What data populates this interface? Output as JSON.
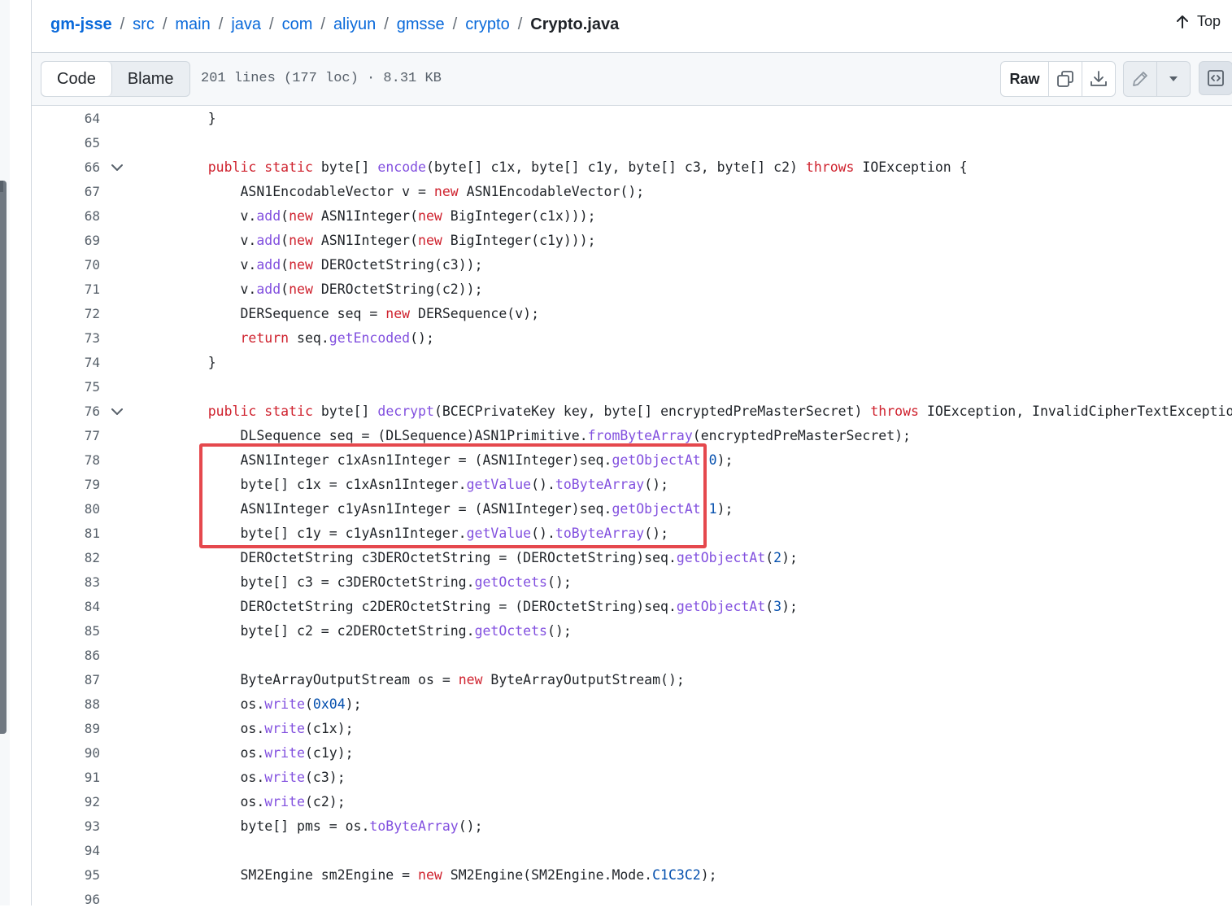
{
  "breadcrumb": {
    "repo": "gm-jsse",
    "segments": [
      "src",
      "main",
      "java",
      "com",
      "aliyun",
      "gmsse",
      "crypto"
    ],
    "separator": "/",
    "current_file": "Crypto.java"
  },
  "top_link": {
    "label": "Top",
    "icon": "arrow-up-icon"
  },
  "file_header": {
    "tabs": [
      "Code",
      "Blame"
    ],
    "active_tab": "Code",
    "meta": "201 lines (177 loc) · 8.31 KB",
    "raw_label": "Raw",
    "icons": [
      "copy-icon",
      "download-icon",
      "pencil-icon",
      "triangle-down-icon",
      "code-symbols-icon"
    ]
  },
  "highlight": {
    "color": "#e5484d",
    "lines": [
      78,
      81
    ]
  },
  "code_lines": [
    {
      "n": "64",
      "t": "    }"
    },
    {
      "n": "65",
      "t": ""
    },
    {
      "n": "66",
      "t": "    public static byte[] encode(byte[] c1x, byte[] c1y, byte[] c3, byte[] c2) throws IOException {",
      "fold": true
    },
    {
      "n": "67",
      "t": "        ASN1EncodableVector v = new ASN1EncodableVector();"
    },
    {
      "n": "68",
      "t": "        v.add(new ASN1Integer(new BigInteger(c1x)));"
    },
    {
      "n": "69",
      "t": "        v.add(new ASN1Integer(new BigInteger(c1y)));"
    },
    {
      "n": "70",
      "t": "        v.add(new DEROctetString(c3));"
    },
    {
      "n": "71",
      "t": "        v.add(new DEROctetString(c2));"
    },
    {
      "n": "72",
      "t": "        DERSequence seq = new DERSequence(v);"
    },
    {
      "n": "73",
      "t": "        return seq.getEncoded();"
    },
    {
      "n": "74",
      "t": "    }"
    },
    {
      "n": "75",
      "t": ""
    },
    {
      "n": "76",
      "t": "    public static byte[] decrypt(BCECPrivateKey key, byte[] encryptedPreMasterSecret) throws IOException, InvalidCipherTextException {",
      "fold": true
    },
    {
      "n": "77",
      "t": "        DLSequence seq = (DLSequence)ASN1Primitive.fromByteArray(encryptedPreMasterSecret);"
    },
    {
      "n": "78",
      "t": "        ASN1Integer c1xAsn1Integer = (ASN1Integer)seq.getObjectAt(0);"
    },
    {
      "n": "79",
      "t": "        byte[] c1x = c1xAsn1Integer.getValue().toByteArray();"
    },
    {
      "n": "80",
      "t": "        ASN1Integer c1yAsn1Integer = (ASN1Integer)seq.getObjectAt(1);"
    },
    {
      "n": "81",
      "t": "        byte[] c1y = c1yAsn1Integer.getValue().toByteArray();"
    },
    {
      "n": "82",
      "t": "        DEROctetString c3DEROctetString = (DEROctetString)seq.getObjectAt(2);"
    },
    {
      "n": "83",
      "t": "        byte[] c3 = c3DEROctetString.getOctets();"
    },
    {
      "n": "84",
      "t": "        DEROctetString c2DEROctetString = (DEROctetString)seq.getObjectAt(3);"
    },
    {
      "n": "85",
      "t": "        byte[] c2 = c2DEROctetString.getOctets();"
    },
    {
      "n": "86",
      "t": ""
    },
    {
      "n": "87",
      "t": "        ByteArrayOutputStream os = new ByteArrayOutputStream();"
    },
    {
      "n": "88",
      "t": "        os.write(0x04);"
    },
    {
      "n": "89",
      "t": "        os.write(c1x);"
    },
    {
      "n": "90",
      "t": "        os.write(c1y);"
    },
    {
      "n": "91",
      "t": "        os.write(c3);"
    },
    {
      "n": "92",
      "t": "        os.write(c2);"
    },
    {
      "n": "93",
      "t": "        byte[] pms = os.toByteArray();"
    },
    {
      "n": "94",
      "t": ""
    },
    {
      "n": "95",
      "t": "        SM2Engine sm2Engine = new SM2Engine(SM2Engine.Mode.C1C3C2);"
    },
    {
      "n": "96",
      "t": ""
    }
  ]
}
